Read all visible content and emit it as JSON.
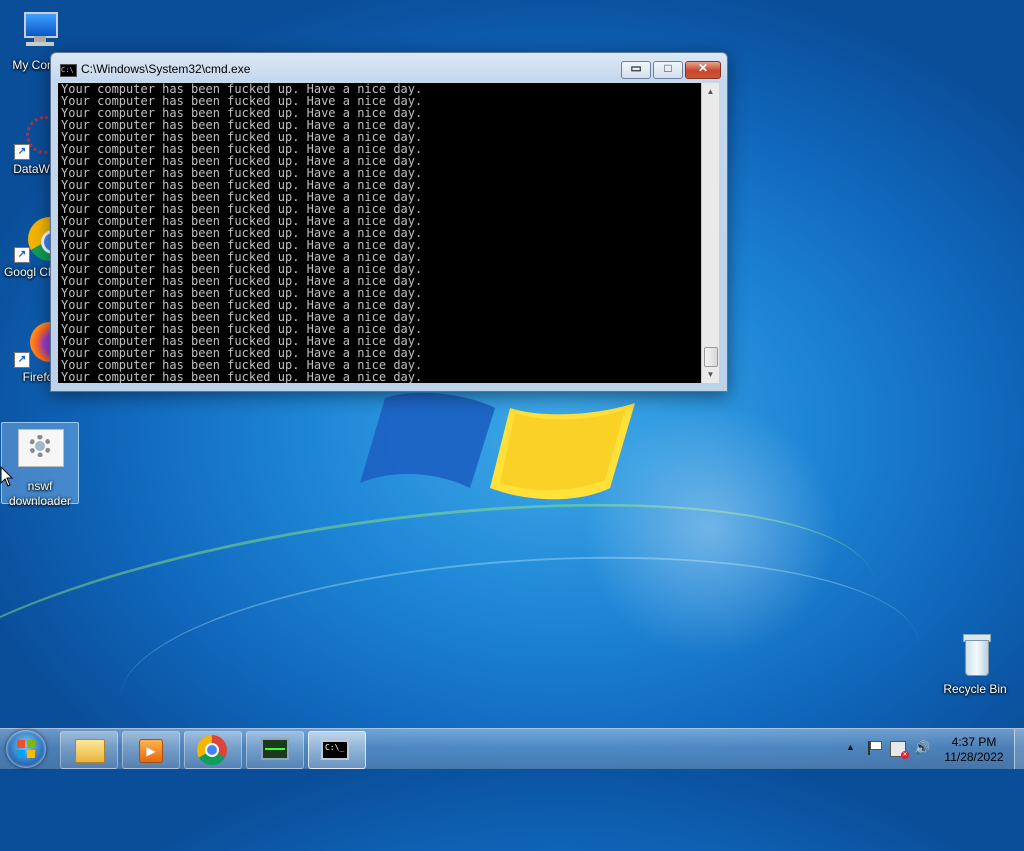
{
  "desktop": {
    "icons": [
      {
        "label": "My Comp"
      },
      {
        "label": "DataWag"
      },
      {
        "label": "Googl Chron"
      },
      {
        "label": "Firefo"
      },
      {
        "label": "nswf downloader"
      },
      {
        "label": "Recycle Bin"
      }
    ]
  },
  "window": {
    "title": "C:\\Windows\\System32\\cmd.exe",
    "icon_text": "C:\\",
    "controls": {
      "minimize": "▭",
      "maximize": "□",
      "close": "✕"
    },
    "console_lines": [
      "Your computer has been fucked up. Have a nice day.",
      "Your computer has been fucked up. Have a nice day.",
      "Your computer has been fucked up. Have a nice day.",
      "Your computer has been fucked up. Have a nice day.",
      "Your computer has been fucked up. Have a nice day.",
      "Your computer has been fucked up. Have a nice day.",
      "Your computer has been fucked up. Have a nice day.",
      "Your computer has been fucked up. Have a nice day.",
      "Your computer has been fucked up. Have a nice day.",
      "Your computer has been fucked up. Have a nice day.",
      "Your computer has been fucked up. Have a nice day.",
      "Your computer has been fucked up. Have a nice day.",
      "Your computer has been fucked up. Have a nice day.",
      "Your computer has been fucked up. Have a nice day.",
      "Your computer has been fucked up. Have a nice day.",
      "Your computer has been fucked up. Have a nice day.",
      "Your computer has been fucked up. Have a nice day.",
      "Your computer has been fucked up. Have a nice day.",
      "Your computer has been fucked up. Have a nice day.",
      "Your computer has been fucked up. Have a nice day.",
      "Your computer has been fucked up. Have a nice day.",
      "Your computer has been fucked up. Have a nice day.",
      "Your computer has been fucked up. Have a nice day.",
      "Your computer has been fucked up. Have a nice day.",
      "Your computer has been fucked up. Have a nice day."
    ]
  },
  "taskbar": {
    "pinned": [
      "windows-explorer-icon",
      "media-player-icon",
      "chrome-icon",
      "task-manager-icon",
      "cmd-icon"
    ],
    "active": "cmd-icon",
    "cmd_icon_text": "C:\\_",
    "tray": {
      "time": "4:37 PM",
      "date": "11/28/2022",
      "show_hidden": "▲"
    }
  },
  "colors": {
    "console_bg": "#000000",
    "console_text": "#c0c0c0",
    "close_red": "#c7462b"
  }
}
